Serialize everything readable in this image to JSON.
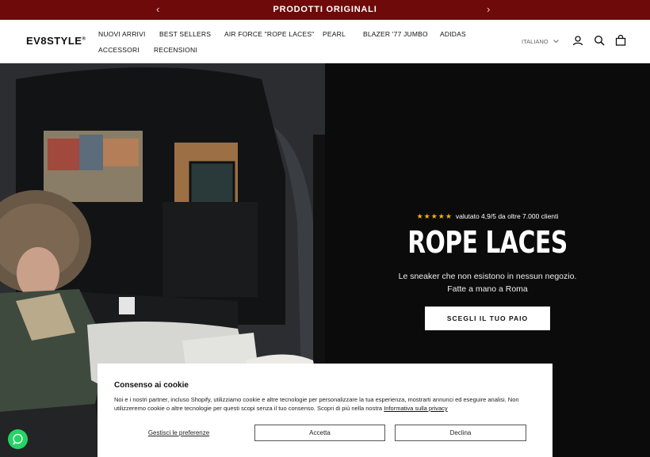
{
  "announcement": {
    "text": "PRODOTTI ORIGINALI",
    "prev": "‹",
    "next": "›"
  },
  "header": {
    "logo": "EV8STYLE",
    "logo_mark": "®",
    "nav": [
      "NUOVI ARRIVI",
      "BEST SELLERS",
      "AIR FORCE \"ROPE LACES\"",
      "PEARL",
      "BLAZER '77 JUMBO",
      "ADIDAS",
      "ACCESSORI",
      "RECENSIONI"
    ],
    "language": "ITALIANO",
    "icons": [
      "account-icon",
      "search-icon",
      "cart-icon"
    ]
  },
  "hero": {
    "stars": "★★★★★",
    "rating_text": "valutato 4,9/5 da oltre 7.000 clienti",
    "title": "ROPE LACES",
    "subtitle_line1": "Le sneaker che non esistono in nessun negozio.",
    "subtitle_line2": "Fatte a mano a Roma",
    "cta": "SCEGLI IL TUO PAIO"
  },
  "consent": {
    "title": "Consenso ai cookie",
    "body": "Noi e i nostri partner, incluso Shopify, utilizziamo cookie e altre tecnologie per personalizzare la tua esperienza, mostrarti annunci ed eseguire analisi. Non utilizzeremo cookie o altre tecnologie per questi scopi senza il tuo consenso. Scopri di più nella nostra ",
    "link": "Informativa sulla privacy",
    "preferences": "Gestisci le preferenze",
    "accept": "Accetta",
    "decline": "Declina"
  },
  "colors": {
    "announcement_bg": "#6e0a0a",
    "hero_bg": "#0b0b0b",
    "stars": "#f5b301",
    "whatsapp": "#25d366"
  }
}
